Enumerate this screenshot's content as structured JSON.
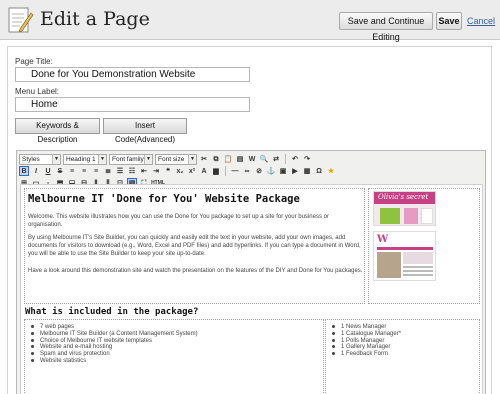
{
  "header": {
    "title": "Edit a Page",
    "save_continue_label": "Save and Continue Editing",
    "save_label": "Save",
    "cancel_label": "Cancel"
  },
  "form": {
    "page_title_label": "Page Title:",
    "page_title_value": "Done for You Demonstration Website",
    "menu_label_label": "Menu Label:",
    "menu_label_value": "Home",
    "keywords_button": "Keywords & Description",
    "insert_code_button": "Insert Code(Advanced)"
  },
  "toolbar": {
    "styles": "Styles",
    "heading": "Heading 1",
    "font_family": "Font family",
    "font_size": "Font size",
    "html_label": "HTML"
  },
  "content": {
    "heading": "Melbourne IT 'Done for You' Website Package",
    "paragraph1": "Welcome. This website illustrates how you can use the Done for You package to set up a site for your business or organisation.",
    "paragraph2": "By using Melbourne IT's Site Builder, you can quickly and easily edit the text in your website, add your own images, add documents for visitors to download (e.g., Word, Excel and PDF files) and add hyperlinks. If you can type a document in Word, you will be able to use the Site Builder to keep your site up-to-date.",
    "paragraph3": "Have a look around this demonstration site and watch the presentation on the features of the DIY and Done for You packages.",
    "thumb_brand": "Olivia's secret",
    "thumb_initial": "W",
    "subheading": "What is included in the package?",
    "list_left": [
      "7 web pages",
      "Melbourne IT Site Builder (a Content Management System)",
      "Choice of Melbourne IT website templates",
      "Website and e-mail hosting",
      "Spam and virus protection",
      "Website statistics"
    ],
    "list_right": [
      "1 News Manager",
      "1 Catalogue Manager*",
      "1 Polls Manager",
      "1 Gallery Manager",
      "1 Feedback Form"
    ]
  },
  "colors": {
    "accent": "#c54183",
    "link": "#3a5fa0"
  }
}
